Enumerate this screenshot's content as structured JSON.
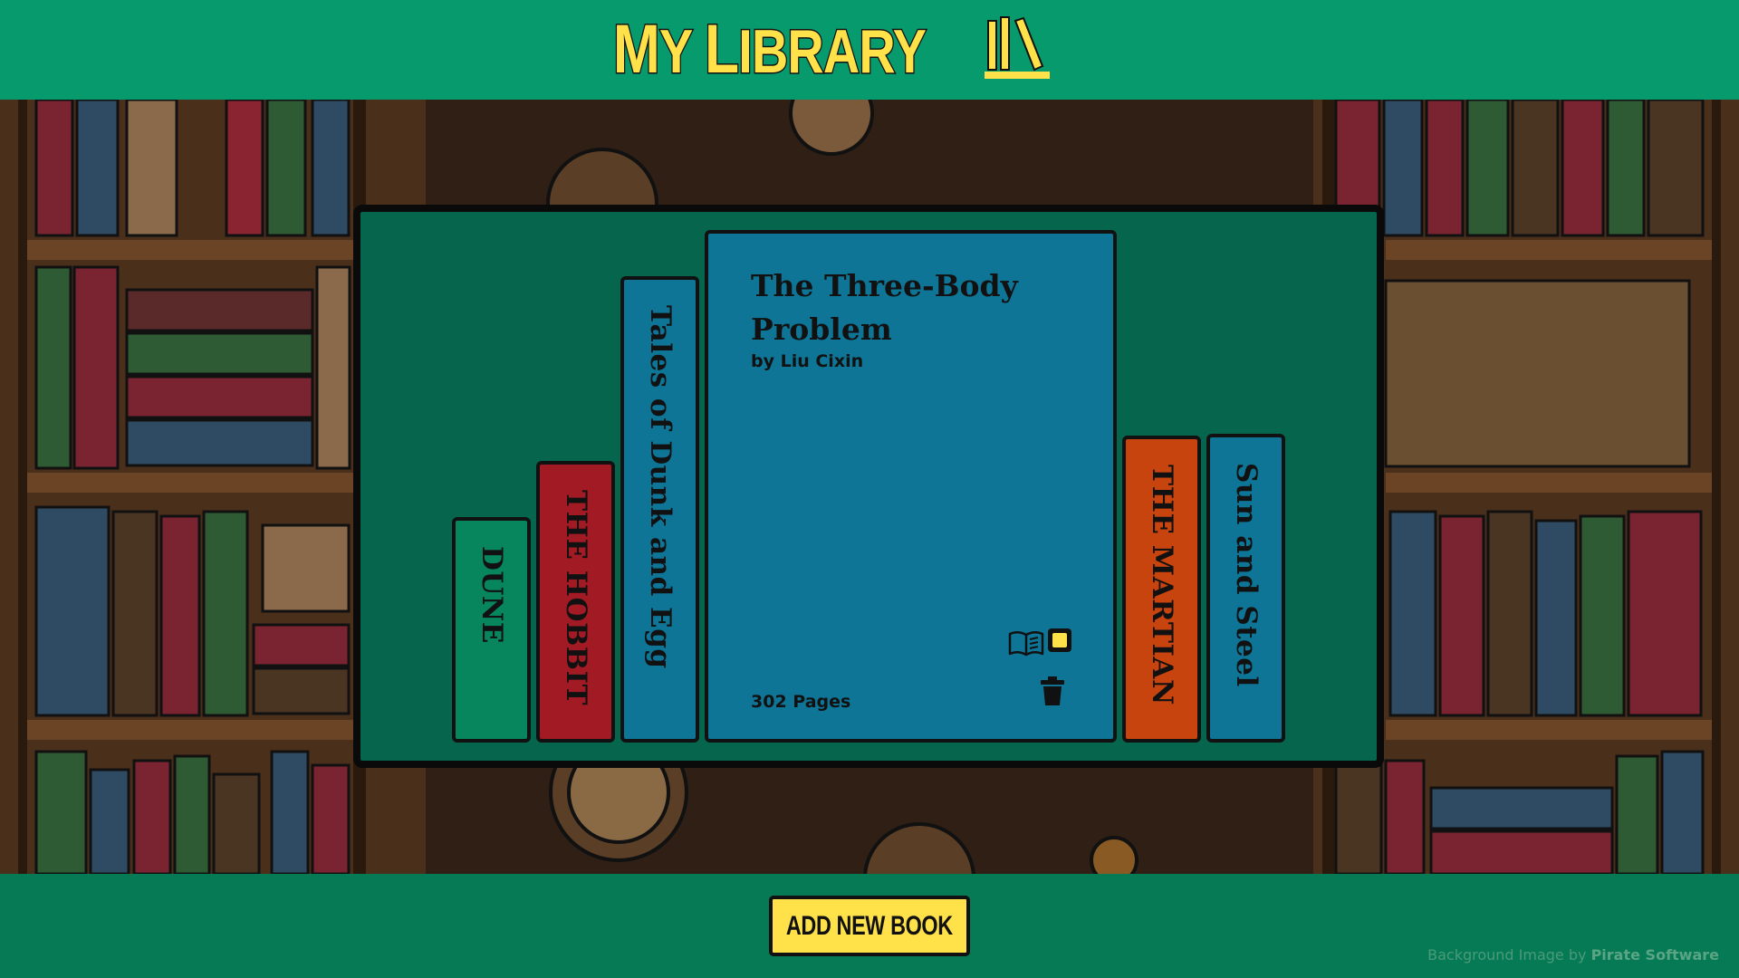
{
  "header": {
    "title_first_letter": "M",
    "title_first_rest": "y",
    "title_second_letter": "L",
    "title_second_rest": "ibrary"
  },
  "books": [
    {
      "title": "Dune",
      "color": "#07855d"
    },
    {
      "title": "The Hobbit",
      "color": "#a21b24"
    },
    {
      "title": "Tales of Dunk and Egg",
      "color": "#0e7597"
    },
    {
      "title": "The Martian",
      "color": "#c8440f"
    },
    {
      "title": "Sun and Steel",
      "color": "#0e7597"
    }
  ],
  "open_book": {
    "title": "The Three-Body Problem",
    "author": "by Liu Cixin",
    "pages": "302 Pages",
    "read": true,
    "color": "#0e7597"
  },
  "footer": {
    "add_button_label": "Add New Book",
    "credit_prefix": "Background Image by",
    "credit_name": "Pirate Software"
  },
  "icons": {
    "logo": "library-books-icon",
    "read": "open-book-icon",
    "delete": "trash-icon"
  },
  "colors": {
    "header_bg": "#079a6c",
    "footer_bg": "#067a55",
    "accent": "#ffe14a",
    "panel_bg": "#06654d"
  }
}
